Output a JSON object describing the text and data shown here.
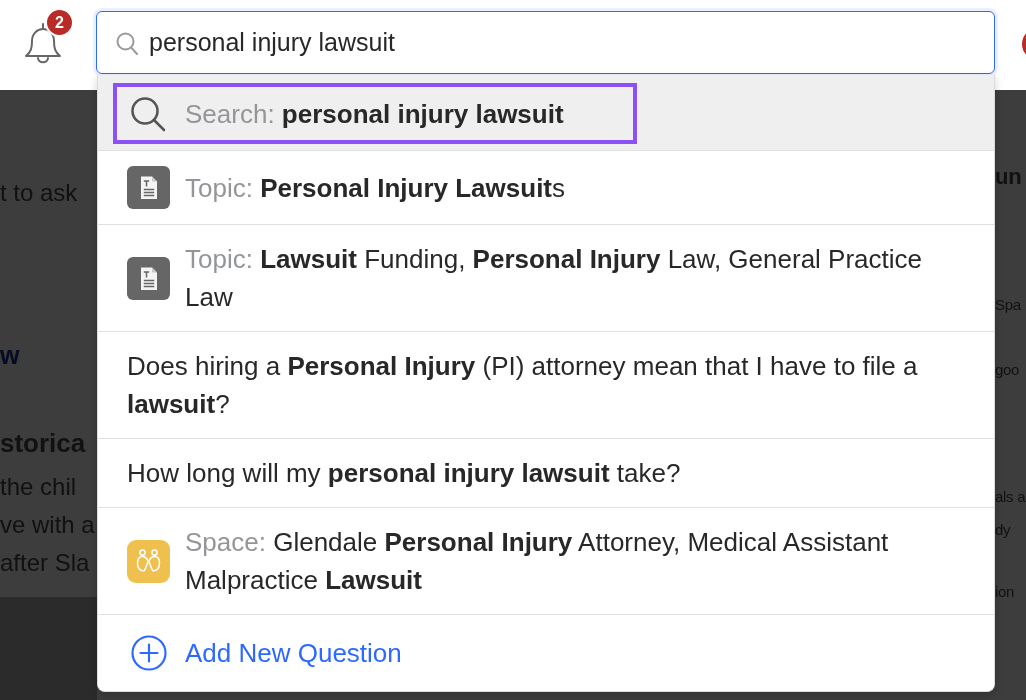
{
  "top_bar": {
    "notifications": {
      "count": "2"
    },
    "search": {
      "value": "personal injury lawsuit"
    }
  },
  "suggestions": [
    {
      "kind": "search",
      "selected": true,
      "highlighted": true,
      "prefix": "Search:",
      "text": "personal injury lawsuit"
    },
    {
      "kind": "topic",
      "selected": false,
      "highlighted": false,
      "prefix": "Topic:",
      "text": "**Personal Injury Lawsuit**s"
    },
    {
      "kind": "topic",
      "selected": false,
      "highlighted": false,
      "prefix": "Topic:",
      "text": "**Lawsuit** Funding, **Personal Injury** Law, General Practice Law"
    },
    {
      "kind": "question",
      "selected": false,
      "highlighted": false,
      "text": "Does hiring a **Personal Injury** (PI) attorney mean that I have to file a **lawsuit**?"
    },
    {
      "kind": "question",
      "selected": false,
      "highlighted": false,
      "text": "How long will my **personal injury lawsuit** take?"
    },
    {
      "kind": "space",
      "selected": false,
      "highlighted": false,
      "prefix": "Space:",
      "text": "Glendale **Personal Injury** Attorney, Medical Assistant Malpractice **Lawsuit**"
    },
    {
      "kind": "action",
      "selected": false,
      "highlighted": false,
      "text": "Add New Question"
    }
  ],
  "background_page": {
    "left_column": [
      {
        "kind": "text",
        "text": "t to ask"
      },
      {
        "kind": "link",
        "text": "w"
      },
      {
        "kind": "heading",
        "text": "storica"
      },
      {
        "kind": "text",
        "text": "the chil"
      },
      {
        "kind": "text",
        "text": "ve with a"
      },
      {
        "kind": "text",
        "text": "after Sla"
      }
    ],
    "right_column": [
      {
        "kind": "heading",
        "text": "un"
      },
      {
        "kind": "text",
        "text": "Spa"
      },
      {
        "kind": "text",
        "text": "goo"
      },
      {
        "kind": "text",
        "text": "als a"
      },
      {
        "kind": "text",
        "text": "dy"
      },
      {
        "kind": "text",
        "text": "ion"
      }
    ]
  }
}
